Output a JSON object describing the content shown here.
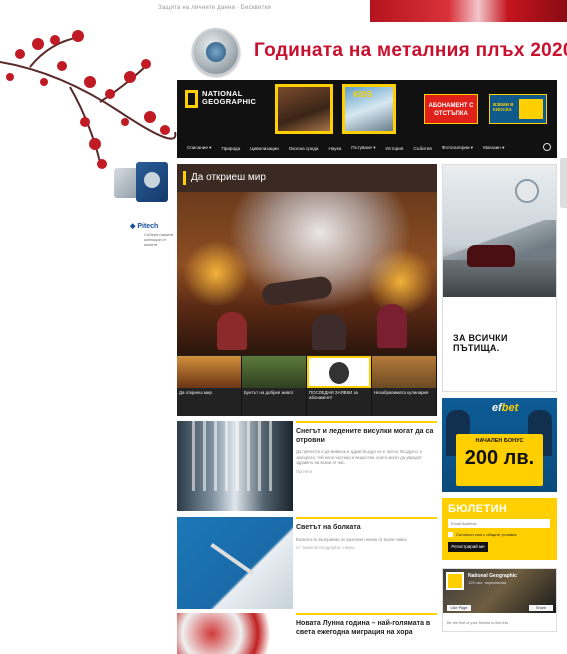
{
  "topbar": {
    "links": "Защита на личните данни · Бисквитки"
  },
  "banner": {
    "title": "Годината на металния плъх 2020"
  },
  "header": {
    "logo_line1": "NATIONAL",
    "logo_line2": "GEOGRAPHIC",
    "kids_label": "KIDS",
    "subscribe_label": "АБОНАМЕНТ С ОТСТЪПКА",
    "promo_label": "ВЗЕМИ В КИОСКА",
    "nav": [
      "Списание ▾",
      "Природа",
      "Цивилизации",
      "Околна среда",
      "Наука",
      "Пътуване ▾",
      "История",
      "Събития",
      "Фотогалерии ▾",
      "Магазин ▾"
    ]
  },
  "left_ad": {
    "brand": "◆ Pitech",
    "tagline": "Събери нашите колекции от монети"
  },
  "feature": {
    "section_title": "Да откриеш мир",
    "thumbs": [
      {
        "caption": "Да откриеш мир"
      },
      {
        "caption": "Бунтът на добрия живот"
      },
      {
        "caption": "ПОСЛЕДНИ ЗАЯВКИ за абонамент!"
      },
      {
        "caption": "Незабравимата кулинария"
      }
    ]
  },
  "articles": [
    {
      "title": "Снегът и ледените висулки могат да са отровни",
      "text": "Да пречисти и да живееш в здрав въздух не е лесно. Въздухът е замърсен, той носи частици и вещества, които могат да увредят здравето на всеки от нас.",
      "more": "Прочети"
    },
    {
      "title": "Светът на болката",
      "text": "Болката се възприема по различен начин от всеки човек.",
      "more": "от: National Geographic, Наука"
    },
    {
      "title": "Новата Лунна година – най-голямата в света ежегодна миграция на хора",
      "text": "",
      "more": ""
    }
  ],
  "sidebar": {
    "volvo_slogan": "ЗА ВСИЧКИ ПЪТИЩА.",
    "efbet_logo_a": "ef",
    "efbet_logo_b": "bet",
    "efbet_offer": "НАЧАЛЕН БОНУС",
    "efbet_amount": "200 лв.",
    "newsletter_title": "БЮЛЕТИН",
    "newsletter_placeholder": "Email Address",
    "newsletter_consent": "Съгласен съм с общите условия",
    "newsletter_button": "Регистрирай ме",
    "fb_name": "National Geographic",
    "fb_likes": "125 хил. харесвания",
    "fb_like": "Like Page",
    "fb_share": "Share",
    "fb_footer": "Be the first of your friends to like this"
  }
}
